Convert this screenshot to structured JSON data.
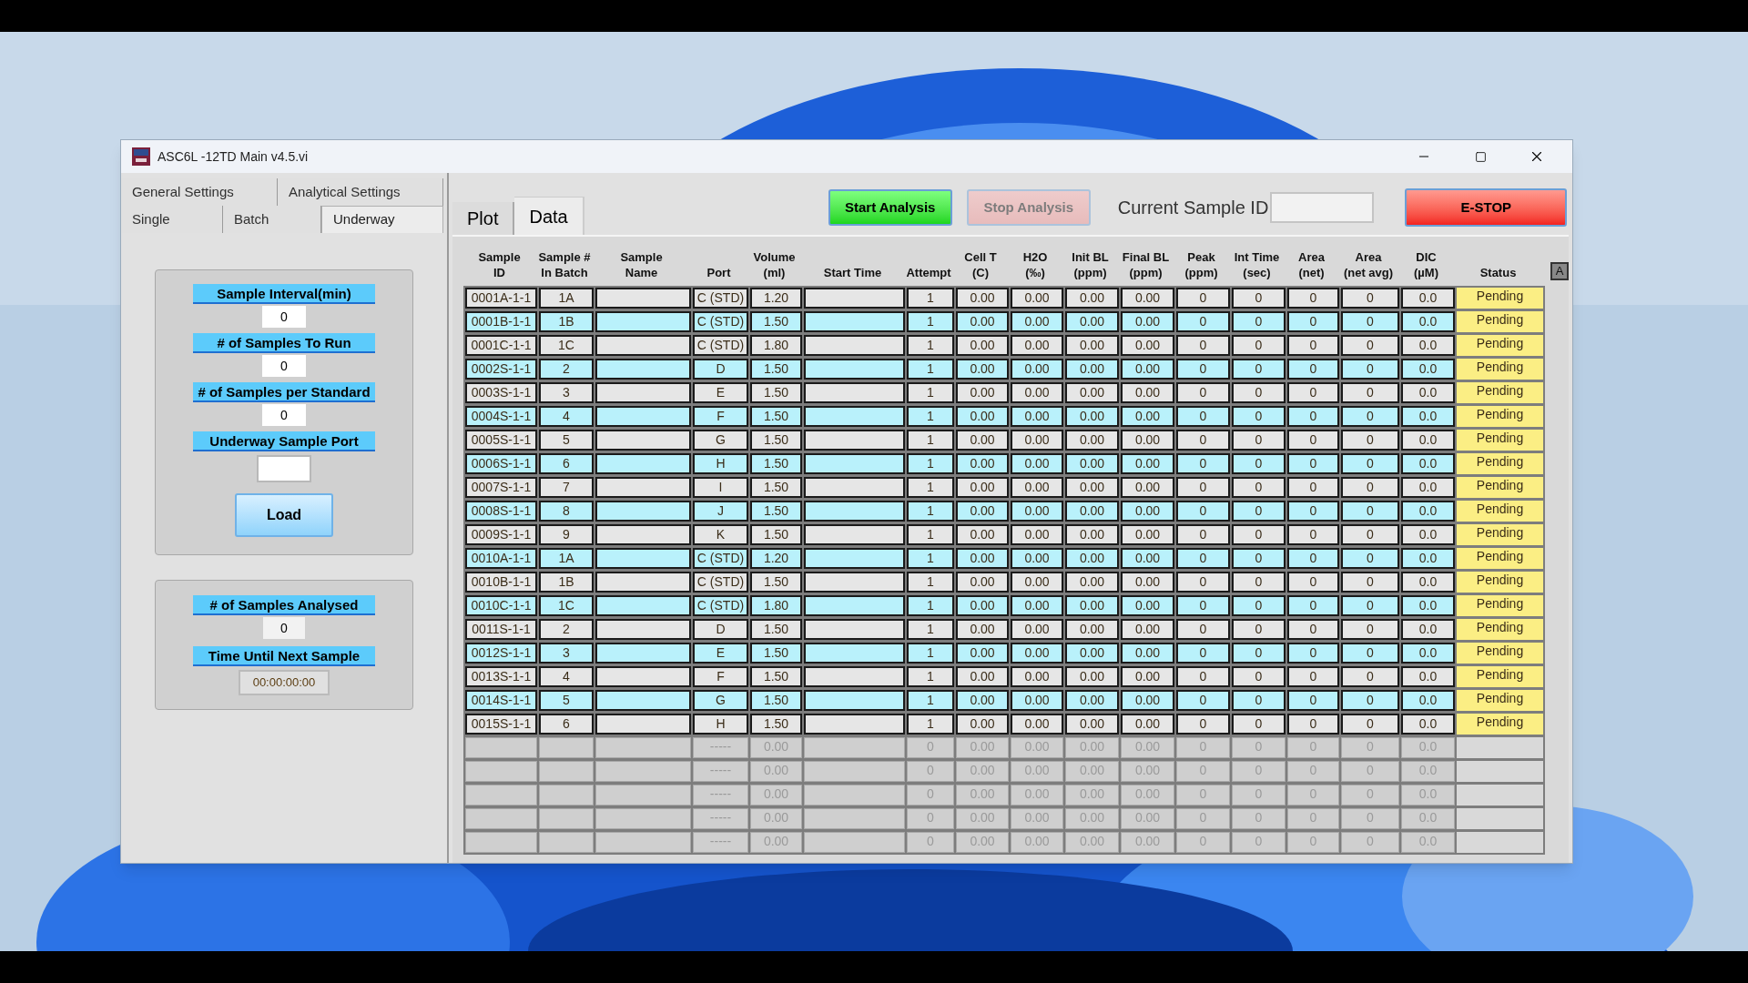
{
  "window": {
    "title": "ASC6L -12TD Main v4.5.vi"
  },
  "settings_tabs": [
    {
      "label": "General Settings",
      "selected": false
    },
    {
      "label": "Analytical Settings",
      "selected": false
    }
  ],
  "mode_tabs": [
    {
      "label": "Single",
      "selected": false
    },
    {
      "label": "Batch",
      "selected": false
    },
    {
      "label": "Underway",
      "selected": true
    }
  ],
  "underway_panel": {
    "fields": [
      {
        "label": "Sample Interval(min)",
        "value": "0"
      },
      {
        "label": "# of Samples To Run",
        "value": "0"
      },
      {
        "label": "# of Samples per Standard",
        "value": "0"
      },
      {
        "label": "Underway Sample Port"
      }
    ],
    "load_button": "Load"
  },
  "status_panel": {
    "fields": [
      {
        "label": "# of Samples Analysed",
        "value": "0",
        "kind": "number"
      },
      {
        "label": "Time Until Next Sample",
        "value": "00:00:00:00",
        "kind": "time"
      }
    ]
  },
  "view_tabs": [
    {
      "label": "Plot",
      "selected": false
    },
    {
      "label": "Data",
      "selected": true
    }
  ],
  "buttons": [
    {
      "label": "Start Analysis",
      "kind": "start",
      "disabled": false
    },
    {
      "label": "Stop Analysis",
      "kind": "stop",
      "disabled": true
    }
  ],
  "current_sample": {
    "label": "Current Sample ID"
  },
  "estop_button": "E-STOP",
  "table": {
    "columns": [
      "Sample\nID",
      "Sample #\nIn Batch",
      "Sample\nName",
      "Port",
      "Volume\n(ml)",
      "Start Time",
      "Attempt",
      "Cell T\n(C)",
      "H2O\n(‰)",
      "Init BL\n(ppm)",
      "Final BL\n(ppm)",
      "Peak\n(ppm)",
      "Int Time\n(sec)",
      "Area\n(net)",
      "Area\n(net avg)",
      "DIC\n(µM)",
      "Status"
    ],
    "corner_button": "A",
    "rows": [
      {
        "kind": "sample",
        "shaded": false,
        "id": "0001A-1-1",
        "batch": "1A",
        "port": "C (STD)",
        "volume": "1.20",
        "attempt": "1",
        "cell_t": "0.00",
        "h2o": "0.00",
        "init_bl": "0.00",
        "final_bl": "0.00",
        "peak": "0",
        "int_time": "0",
        "area": "0",
        "area_avg": "0",
        "dic": "0.0",
        "status": "Pending"
      },
      {
        "kind": "sample",
        "shaded": true,
        "id": "0001B-1-1",
        "batch": "1B",
        "port": "C (STD)",
        "volume": "1.50",
        "attempt": "1",
        "cell_t": "0.00",
        "h2o": "0.00",
        "init_bl": "0.00",
        "final_bl": "0.00",
        "peak": "0",
        "int_time": "0",
        "area": "0",
        "area_avg": "0",
        "dic": "0.0",
        "status": "Pending"
      },
      {
        "kind": "sample",
        "shaded": false,
        "id": "0001C-1-1",
        "batch": "1C",
        "port": "C (STD)",
        "volume": "1.80",
        "attempt": "1",
        "cell_t": "0.00",
        "h2o": "0.00",
        "init_bl": "0.00",
        "final_bl": "0.00",
        "peak": "0",
        "int_time": "0",
        "area": "0",
        "area_avg": "0",
        "dic": "0.0",
        "status": "Pending"
      },
      {
        "kind": "sample",
        "shaded": true,
        "id": "0002S-1-1",
        "batch": "2",
        "port": "D",
        "volume": "1.50",
        "attempt": "1",
        "cell_t": "0.00",
        "h2o": "0.00",
        "init_bl": "0.00",
        "final_bl": "0.00",
        "peak": "0",
        "int_time": "0",
        "area": "0",
        "area_avg": "0",
        "dic": "0.0",
        "status": "Pending"
      },
      {
        "kind": "sample",
        "shaded": false,
        "id": "0003S-1-1",
        "batch": "3",
        "port": "E",
        "volume": "1.50",
        "attempt": "1",
        "cell_t": "0.00",
        "h2o": "0.00",
        "init_bl": "0.00",
        "final_bl": "0.00",
        "peak": "0",
        "int_time": "0",
        "area": "0",
        "area_avg": "0",
        "dic": "0.0",
        "status": "Pending"
      },
      {
        "kind": "sample",
        "shaded": true,
        "id": "0004S-1-1",
        "batch": "4",
        "port": "F",
        "volume": "1.50",
        "attempt": "1",
        "cell_t": "0.00",
        "h2o": "0.00",
        "init_bl": "0.00",
        "final_bl": "0.00",
        "peak": "0",
        "int_time": "0",
        "area": "0",
        "area_avg": "0",
        "dic": "0.0",
        "status": "Pending"
      },
      {
        "kind": "sample",
        "shaded": false,
        "id": "0005S-1-1",
        "batch": "5",
        "port": "G",
        "volume": "1.50",
        "attempt": "1",
        "cell_t": "0.00",
        "h2o": "0.00",
        "init_bl": "0.00",
        "final_bl": "0.00",
        "peak": "0",
        "int_time": "0",
        "area": "0",
        "area_avg": "0",
        "dic": "0.0",
        "status": "Pending"
      },
      {
        "kind": "sample",
        "shaded": true,
        "id": "0006S-1-1",
        "batch": "6",
        "port": "H",
        "volume": "1.50",
        "attempt": "1",
        "cell_t": "0.00",
        "h2o": "0.00",
        "init_bl": "0.00",
        "final_bl": "0.00",
        "peak": "0",
        "int_time": "0",
        "area": "0",
        "area_avg": "0",
        "dic": "0.0",
        "status": "Pending"
      },
      {
        "kind": "sample",
        "shaded": false,
        "id": "0007S-1-1",
        "batch": "7",
        "port": "I",
        "volume": "1.50",
        "attempt": "1",
        "cell_t": "0.00",
        "h2o": "0.00",
        "init_bl": "0.00",
        "final_bl": "0.00",
        "peak": "0",
        "int_time": "0",
        "area": "0",
        "area_avg": "0",
        "dic": "0.0",
        "status": "Pending"
      },
      {
        "kind": "sample",
        "shaded": true,
        "id": "0008S-1-1",
        "batch": "8",
        "port": "J",
        "volume": "1.50",
        "attempt": "1",
        "cell_t": "0.00",
        "h2o": "0.00",
        "init_bl": "0.00",
        "final_bl": "0.00",
        "peak": "0",
        "int_time": "0",
        "area": "0",
        "area_avg": "0",
        "dic": "0.0",
        "status": "Pending"
      },
      {
        "kind": "sample",
        "shaded": false,
        "id": "0009S-1-1",
        "batch": "9",
        "port": "K",
        "volume": "1.50",
        "attempt": "1",
        "cell_t": "0.00",
        "h2o": "0.00",
        "init_bl": "0.00",
        "final_bl": "0.00",
        "peak": "0",
        "int_time": "0",
        "area": "0",
        "area_avg": "0",
        "dic": "0.0",
        "status": "Pending"
      },
      {
        "kind": "sample",
        "shaded": true,
        "id": "0010A-1-1",
        "batch": "1A",
        "port": "C (STD)",
        "volume": "1.20",
        "attempt": "1",
        "cell_t": "0.00",
        "h2o": "0.00",
        "init_bl": "0.00",
        "final_bl": "0.00",
        "peak": "0",
        "int_time": "0",
        "area": "0",
        "area_avg": "0",
        "dic": "0.0",
        "status": "Pending"
      },
      {
        "kind": "sample",
        "shaded": false,
        "id": "0010B-1-1",
        "batch": "1B",
        "port": "C (STD)",
        "volume": "1.50",
        "attempt": "1",
        "cell_t": "0.00",
        "h2o": "0.00",
        "init_bl": "0.00",
        "final_bl": "0.00",
        "peak": "0",
        "int_time": "0",
        "area": "0",
        "area_avg": "0",
        "dic": "0.0",
        "status": "Pending"
      },
      {
        "kind": "sample",
        "shaded": true,
        "id": "0010C-1-1",
        "batch": "1C",
        "port": "C (STD)",
        "volume": "1.80",
        "attempt": "1",
        "cell_t": "0.00",
        "h2o": "0.00",
        "init_bl": "0.00",
        "final_bl": "0.00",
        "peak": "0",
        "int_time": "0",
        "area": "0",
        "area_avg": "0",
        "dic": "0.0",
        "status": "Pending"
      },
      {
        "kind": "sample",
        "shaded": false,
        "id": "0011S-1-1",
        "batch": "2",
        "port": "D",
        "volume": "1.50",
        "attempt": "1",
        "cell_t": "0.00",
        "h2o": "0.00",
        "init_bl": "0.00",
        "final_bl": "0.00",
        "peak": "0",
        "int_time": "0",
        "area": "0",
        "area_avg": "0",
        "dic": "0.0",
        "status": "Pending"
      },
      {
        "kind": "sample",
        "shaded": true,
        "id": "0012S-1-1",
        "batch": "3",
        "port": "E",
        "volume": "1.50",
        "attempt": "1",
        "cell_t": "0.00",
        "h2o": "0.00",
        "init_bl": "0.00",
        "final_bl": "0.00",
        "peak": "0",
        "int_time": "0",
        "area": "0",
        "area_avg": "0",
        "dic": "0.0",
        "status": "Pending"
      },
      {
        "kind": "sample",
        "shaded": false,
        "id": "0013S-1-1",
        "batch": "4",
        "port": "F",
        "volume": "1.50",
        "attempt": "1",
        "cell_t": "0.00",
        "h2o": "0.00",
        "init_bl": "0.00",
        "final_bl": "0.00",
        "peak": "0",
        "int_time": "0",
        "area": "0",
        "area_avg": "0",
        "dic": "0.0",
        "status": "Pending"
      },
      {
        "kind": "sample",
        "shaded": true,
        "id": "0014S-1-1",
        "batch": "5",
        "port": "G",
        "volume": "1.50",
        "attempt": "1",
        "cell_t": "0.00",
        "h2o": "0.00",
        "init_bl": "0.00",
        "final_bl": "0.00",
        "peak": "0",
        "int_time": "0",
        "area": "0",
        "area_avg": "0",
        "dic": "0.0",
        "status": "Pending"
      },
      {
        "kind": "sample",
        "shaded": false,
        "id": "0015S-1-1",
        "batch": "6",
        "port": "H",
        "volume": "1.50",
        "attempt": "1",
        "cell_t": "0.00",
        "h2o": "0.00",
        "init_bl": "0.00",
        "final_bl": "0.00",
        "peak": "0",
        "int_time": "0",
        "area": "0",
        "area_avg": "0",
        "dic": "0.0",
        "status": "Pending"
      },
      {
        "kind": "empty",
        "port": "-----",
        "volume": "0.00",
        "attempt": "0",
        "cell_t": "0.00",
        "h2o": "0.00",
        "init_bl": "0.00",
        "final_bl": "0.00",
        "peak": "0",
        "int_time": "0",
        "area": "0",
        "area_avg": "0",
        "dic": "0.0"
      },
      {
        "kind": "empty",
        "port": "-----",
        "volume": "0.00",
        "attempt": "0",
        "cell_t": "0.00",
        "h2o": "0.00",
        "init_bl": "0.00",
        "final_bl": "0.00",
        "peak": "0",
        "int_time": "0",
        "area": "0",
        "area_avg": "0",
        "dic": "0.0"
      },
      {
        "kind": "empty",
        "port": "-----",
        "volume": "0.00",
        "attempt": "0",
        "cell_t": "0.00",
        "h2o": "0.00",
        "init_bl": "0.00",
        "final_bl": "0.00",
        "peak": "0",
        "int_time": "0",
        "area": "0",
        "area_avg": "0",
        "dic": "0.0"
      },
      {
        "kind": "empty",
        "port": "-----",
        "volume": "0.00",
        "attempt": "0",
        "cell_t": "0.00",
        "h2o": "0.00",
        "init_bl": "0.00",
        "final_bl": "0.00",
        "peak": "0",
        "int_time": "0",
        "area": "0",
        "area_avg": "0",
        "dic": "0.0"
      },
      {
        "kind": "empty",
        "port": "-----",
        "volume": "0.00",
        "attempt": "0",
        "cell_t": "0.00",
        "h2o": "0.00",
        "init_bl": "0.00",
        "final_bl": "0.00",
        "peak": "0",
        "int_time": "0",
        "area": "0",
        "area_avg": "0",
        "dic": "0.0"
      }
    ]
  }
}
